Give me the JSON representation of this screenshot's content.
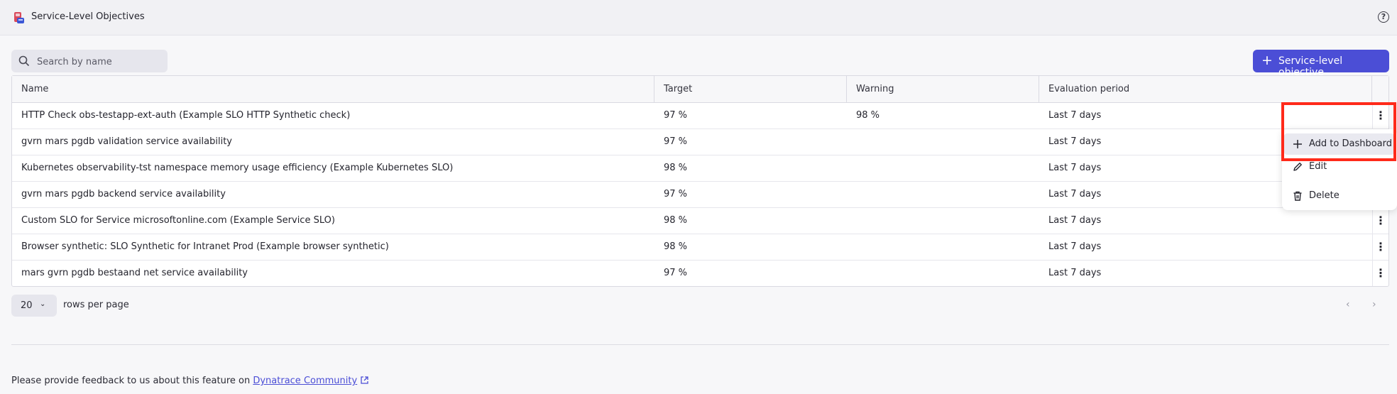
{
  "header": {
    "title": "Service-Level Objectives"
  },
  "toolbar": {
    "search_placeholder": "Search by name",
    "add_button_label": "Service-level objective"
  },
  "table": {
    "columns": [
      "Name",
      "Target",
      "Warning",
      "Evaluation period"
    ],
    "rows": [
      {
        "name": "HTTP Check obs-testapp-ext-auth (Example SLO HTTP Synthetic check)",
        "target": "97 %",
        "warning": "98 %",
        "period": "Last 7 days"
      },
      {
        "name": "gvrn mars pgdb validation service availability",
        "target": "97 %",
        "warning": "",
        "period": "Last 7 days"
      },
      {
        "name": "Kubernetes observability-tst namespace memory usage efficiency (Example Kubernetes SLO)",
        "target": "98 %",
        "warning": "",
        "period": "Last 7 days"
      },
      {
        "name": "gvrn mars pgdb backend service availability",
        "target": "97 %",
        "warning": "",
        "period": "Last 7 days"
      },
      {
        "name": "Custom SLO for Service microsoftonline.com (Example Service SLO)",
        "target": "98 %",
        "warning": "",
        "period": "Last 7 days"
      },
      {
        "name": "Browser synthetic: SLO Synthetic for Intranet Prod (Example browser synthetic)",
        "target": "98 %",
        "warning": "",
        "period": "Last 7 days"
      },
      {
        "name": "mars gvrn pgdb bestaand net service availability",
        "target": "97 %",
        "warning": "",
        "period": "Last 7 days"
      }
    ]
  },
  "context_menu": {
    "items": [
      "Add to Dashboard",
      "Edit",
      "Delete"
    ]
  },
  "pagination": {
    "rows_per_page_value": "20",
    "rows_per_page_label": "rows per page"
  },
  "footer": {
    "text": "Please provide feedback to us about this feature on ",
    "link_text": "Dynatrace Community"
  },
  "colors": {
    "accent": "#4b4ed6",
    "highlight": "#ff2a1a"
  }
}
